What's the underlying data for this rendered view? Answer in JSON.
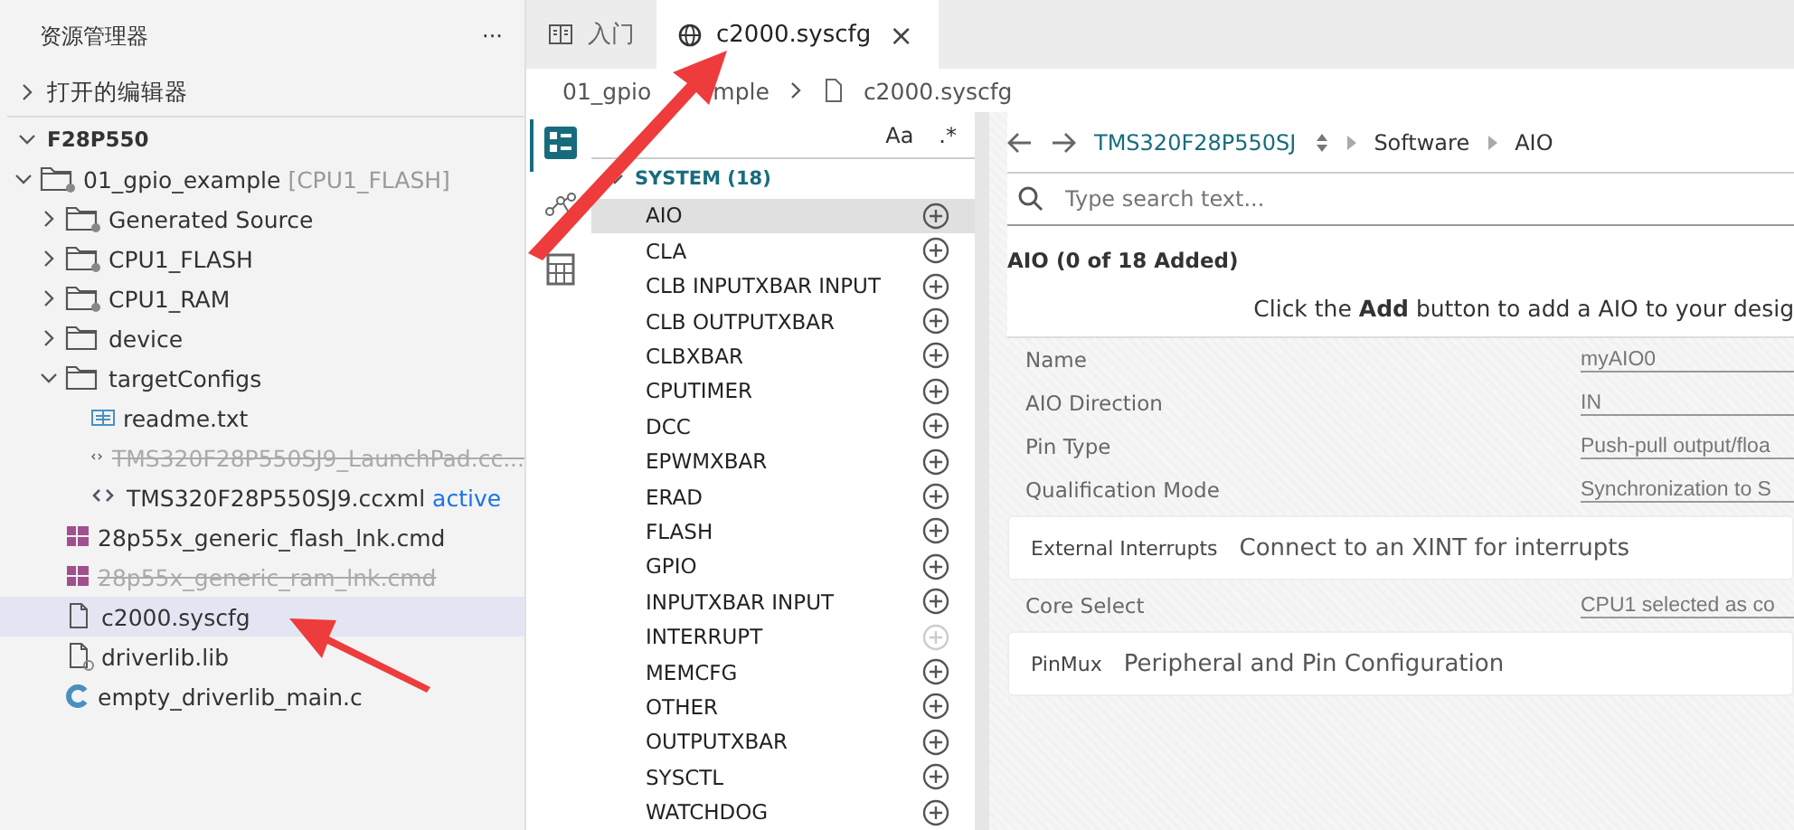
{
  "sidebar": {
    "title": "资源管理器",
    "more": "···",
    "sections": [
      {
        "label": "打开的编辑器",
        "expanded": false
      },
      {
        "label": "F28P550",
        "expanded": true,
        "children": [
          {
            "label": "01_gpio_example",
            "suffix": "[CPU1_FLASH]",
            "kind": "project",
            "expanded": true,
            "selected": false,
            "disabled": false,
            "children": [
              {
                "label": "Generated Source",
                "kind": "folder-special",
                "expanded": false,
                "selected": false,
                "disabled": false
              },
              {
                "label": "CPU1_FLASH",
                "kind": "folder-gear",
                "expanded": false,
                "selected": false,
                "disabled": false
              },
              {
                "label": "CPU1_RAM",
                "kind": "folder-gear",
                "expanded": false,
                "selected": false,
                "disabled": false
              },
              {
                "label": "device",
                "kind": "folder",
                "expanded": false,
                "selected": false,
                "disabled": false
              },
              {
                "label": "targetConfigs",
                "kind": "folder",
                "expanded": true,
                "selected": false,
                "disabled": false,
                "children": [
                  {
                    "label": "readme.txt",
                    "kind": "text",
                    "selected": false,
                    "disabled": false
                  },
                  {
                    "label": "TMS320F28P550SJ9_LaunchPad.cc...",
                    "kind": "xml",
                    "selected": false,
                    "disabled": true
                  },
                  {
                    "label": "TMS320F28P550SJ9.ccxml",
                    "badge": "active",
                    "kind": "xml",
                    "selected": false,
                    "disabled": false
                  }
                ]
              },
              {
                "label": "28p55x_generic_flash_lnk.cmd",
                "kind": "cmd",
                "selected": false,
                "disabled": false
              },
              {
                "label": "28p55x_generic_ram_lnk.cmd",
                "kind": "cmd",
                "selected": false,
                "disabled": true
              },
              {
                "label": "c2000.syscfg",
                "kind": "file",
                "selected": true,
                "disabled": false
              },
              {
                "label": "driverlib.lib",
                "kind": "file-excluded",
                "selected": false,
                "disabled": false
              },
              {
                "label": "empty_driverlib_main.c",
                "kind": "c",
                "selected": false,
                "disabled": false
              }
            ]
          }
        ]
      }
    ]
  },
  "tabs": [
    {
      "label": "入门",
      "kind": "book",
      "selected": false
    },
    {
      "label": "c2000.syscfg",
      "kind": "globe",
      "selected": true,
      "close": "×"
    }
  ],
  "breadcrumb": [
    {
      "parts": [
        "01_gpio",
        "mple"
      ]
    },
    {
      "parts": [
        "c2000.syscfg"
      ]
    }
  ],
  "activity": [
    {
      "kind": "list",
      "selected": true
    },
    {
      "kind": "nodes",
      "selected": false
    },
    {
      "kind": "calc",
      "selected": false
    }
  ],
  "modules": {
    "filter_toggles": [
      "Aa",
      ".*"
    ],
    "group": "SYSTEM (18)",
    "items": [
      {
        "label": "AIO",
        "selected": true,
        "disabled": false
      },
      {
        "label": "CLA",
        "selected": false,
        "disabled": false
      },
      {
        "label": "CLB INPUTXBAR INPUT",
        "selected": false,
        "disabled": false
      },
      {
        "label": "CLB OUTPUTXBAR",
        "selected": false,
        "disabled": false
      },
      {
        "label": "CLBXBAR",
        "selected": false,
        "disabled": false
      },
      {
        "label": "CPUTIMER",
        "selected": false,
        "disabled": false
      },
      {
        "label": "DCC",
        "selected": false,
        "disabled": false
      },
      {
        "label": "EPWMXBAR",
        "selected": false,
        "disabled": false
      },
      {
        "label": "ERAD",
        "selected": false,
        "disabled": false
      },
      {
        "label": "FLASH",
        "selected": false,
        "disabled": false
      },
      {
        "label": "GPIO",
        "selected": false,
        "disabled": false
      },
      {
        "label": "INPUTXBAR INPUT",
        "selected": false,
        "disabled": false
      },
      {
        "label": "INTERRUPT",
        "selected": false,
        "disabled": true
      },
      {
        "label": "MEMCFG",
        "selected": false,
        "disabled": false
      },
      {
        "label": "OTHER",
        "selected": false,
        "disabled": false
      },
      {
        "label": "OUTPUTXBAR",
        "selected": false,
        "disabled": false
      },
      {
        "label": "SYSCTL",
        "selected": false,
        "disabled": false
      },
      {
        "label": "WATCHDOG",
        "selected": false,
        "disabled": false
      }
    ]
  },
  "panel": {
    "device": "TMS320F28P550SJ",
    "path": [
      "Software",
      "AIO"
    ],
    "search_placeholder": "Type search text...",
    "heading": "AIO (0 of 18 Added)",
    "hint": "Click the **Add** button to add a AIO to your desig",
    "rows": [
      {
        "kind": "field",
        "label": "Name",
        "value": "myAIO0"
      },
      {
        "kind": "field",
        "label": "AIO Direction",
        "value": "IN"
      },
      {
        "kind": "field",
        "label": "Pin Type",
        "value": "Push-pull output/floa"
      },
      {
        "kind": "field",
        "label": "Qualification Mode",
        "value": "Synchronization to S"
      },
      {
        "kind": "card",
        "label": "External Interrupts",
        "value": "Connect to an XINT for interrupts"
      },
      {
        "kind": "field",
        "label": "Core Select",
        "value": "CPU1 selected as co"
      },
      {
        "kind": "card",
        "label": "PinMux",
        "value": "Peripheral and Pin Configuration"
      }
    ]
  }
}
